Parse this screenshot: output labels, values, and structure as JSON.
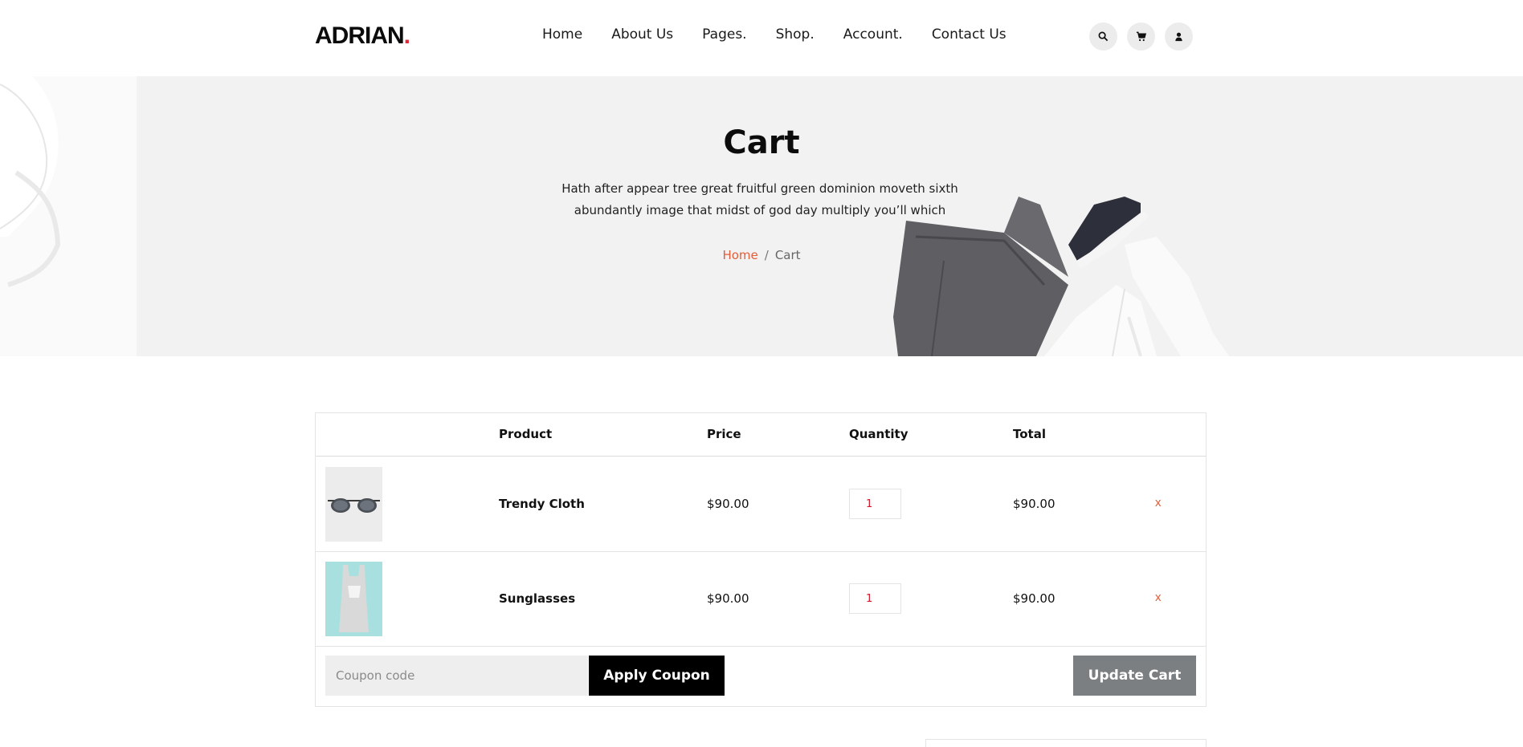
{
  "brand": {
    "name": "ADRIAN",
    "dot": ".",
    "dot_color": "#e0293b"
  },
  "nav": {
    "items": [
      {
        "label": "Home"
      },
      {
        "label": "About Us"
      },
      {
        "label": "Pages."
      },
      {
        "label": "Shop."
      },
      {
        "label": "Account."
      },
      {
        "label": "Contact Us"
      }
    ]
  },
  "header_icons": [
    "search-icon",
    "cart-icon",
    "user-icon"
  ],
  "banner": {
    "title": "Cart",
    "description": "Hath after appear tree great fruitful green dominion moveth sixth abundantly image that midst of god day multiply you’ll which",
    "breadcrumb": {
      "home": "Home",
      "separator": "/",
      "current": "Cart"
    }
  },
  "cart": {
    "headers": {
      "product": "Product",
      "price": "Price",
      "quantity": "Quantity",
      "total": "Total"
    },
    "rows": [
      {
        "image": "sunglasses-thumbnail",
        "name": "Trendy Cloth",
        "price": "$90.00",
        "quantity": "1",
        "total": "$90.00",
        "remove": "x"
      },
      {
        "image": "tank-top-thumbnail",
        "name": "Sunglasses",
        "price": "$90.00",
        "quantity": "1",
        "total": "$90.00",
        "remove": "x"
      }
    ],
    "coupon_placeholder": "Coupon code",
    "apply_label": "Apply Coupon",
    "update_label": "Update Cart"
  },
  "colors": {
    "accent": "#e35d3a",
    "qty_text": "#d0192b",
    "update_bg": "#7b7f82",
    "banner_bg": "#f3f2f2"
  }
}
